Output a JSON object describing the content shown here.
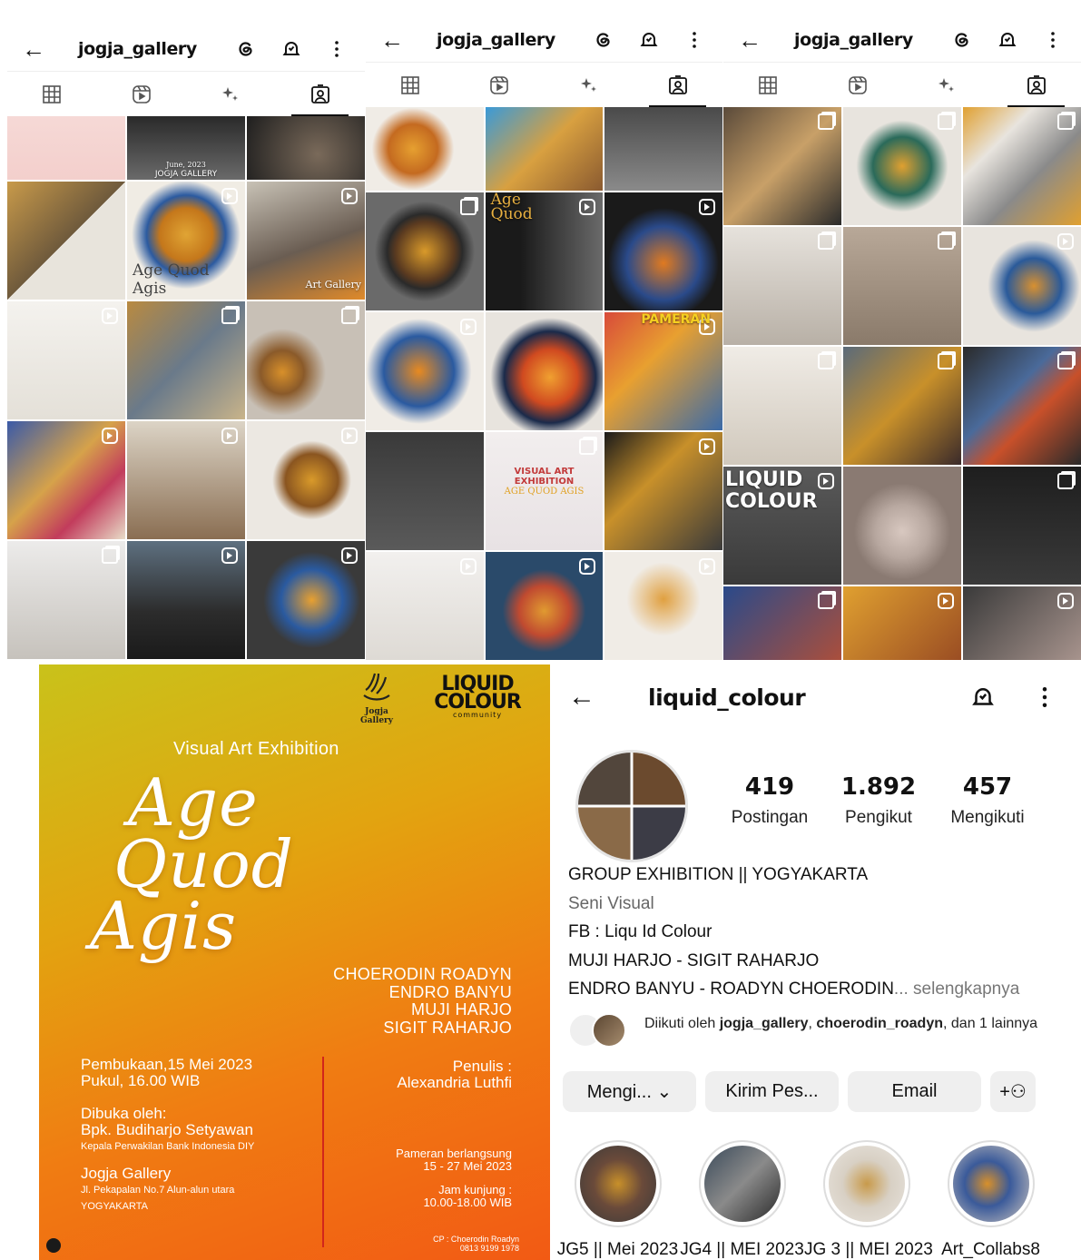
{
  "screens": [
    {
      "back": "←",
      "username": "jogja_gallery"
    },
    {
      "back": "←",
      "username": "jogja_gallery"
    },
    {
      "back": "←",
      "username": "jogja_gallery"
    }
  ],
  "grid1_overlays": {
    "date": "June, 2023",
    "venue": "JOGJA GALLERY",
    "title": "Age Quod Agis",
    "tag": "Art Gallery"
  },
  "grid2_overlays": {
    "title1": "Age",
    "title2": "Quod",
    "poster_title": "VISUAL ART EXHIBITION",
    "poster_sub": "AGE QUOD AGIS",
    "pameran": "PAMERAN"
  },
  "grid3_overlays": {
    "lc1": "LIQUID",
    "lc2": "COLOUR"
  },
  "poster": {
    "jg_logo": "Jogja Gallery",
    "lc_logo_top": "LIQUID",
    "lc_logo_bottom": "COLOUR",
    "lc_logo_sub": "community",
    "subtitle": "Visual Art Exhibition",
    "title_line1": "Age",
    "title_line2": "Quod",
    "title_line3": "Agis",
    "artists": [
      "CHOERODIN ROADYN",
      "ENDRO BANYU",
      "MUJI HARJO",
      "SIGIT RAHARJO"
    ],
    "opening": "Pembukaan,15  Mei 2023",
    "time": "Pukul,  16.00 WIB",
    "opened_by_label": "Dibuka oleh:",
    "opened_by": "Bpk. Budiharjo Setyawan",
    "opened_by_role": "Kepala Perwakilan Bank Indonesia DIY",
    "venue": "Jogja Gallery",
    "address": "Jl. Pekapalan No.7 Alun-alun utara",
    "city": "YOGYAKARTA",
    "writer_label": "Penulis :",
    "writer": "Alexandria Luthfi",
    "duration_label": "Pameran berlangsung",
    "duration": "15 - 27 Mei 2023",
    "visit_label": "Jam kunjung :",
    "visit_hours": "10.00-18.00 WIB",
    "cp_label": "CP : Choerodin Roadyn",
    "cp_phone": "0813 9199 1978"
  },
  "profile": {
    "back": "←",
    "username": "liquid_colour",
    "stats": [
      {
        "num": "419",
        "label": "Postingan"
      },
      {
        "num": "1.892",
        "label": "Pengikut"
      },
      {
        "num": "457",
        "label": "Mengikuti"
      }
    ],
    "bio_line1": "GROUP EXHIBITION || YOGYAKARTA",
    "category": "Seni Visual",
    "bio_line2": "FB : Liqu Id Colour",
    "bio_line3": "MUJI HARJO - SIGIT RAHARJO",
    "bio_line4": "ENDRO BANYU - ROADYN CHOERODIN",
    "more": "... selengkapnya",
    "followed_prefix": "Diikuti oleh ",
    "followed_user1": "jogja_gallery",
    "followed_sep": ", ",
    "followed_user2": "choerodin_roadyn",
    "followed_suffix": ", dan 1 lainnya",
    "btn_following": "Mengi... ⌄",
    "btn_message": "Kirim Pes...",
    "btn_email": "Email",
    "btn_add": "+⚇",
    "highlights": [
      "JG5 || Mei 2023",
      "JG4 || MEI 2023",
      "JG 3 || MEI 2023",
      "Art_Collabs8"
    ]
  },
  "colors": {
    "poster_top": "#c9c21a",
    "poster_bottom": "#f25a14",
    "accent_line": "#d2261b"
  }
}
